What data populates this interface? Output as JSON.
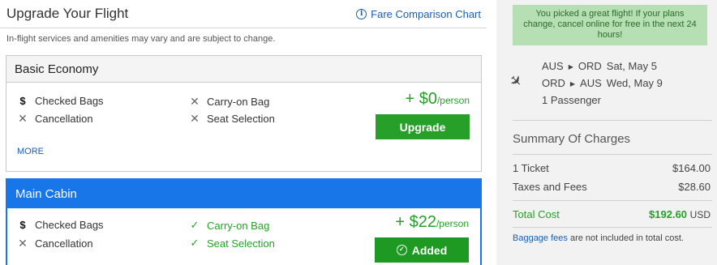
{
  "header": {
    "title": "Upgrade Your Flight",
    "fare_link": "Fare Comparison Chart",
    "disclaimer": "In-flight services and amenities may vary and are subject to change."
  },
  "fares": [
    {
      "name": "Basic Economy",
      "features": {
        "checked_bags": "Checked Bags",
        "cancellation": "Cancellation",
        "carry_on": "Carry-on Bag",
        "seat_selection": "Seat Selection"
      },
      "price": "+ $0",
      "per": "/person",
      "button": "Upgrade",
      "more": "MORE"
    },
    {
      "name": "Main Cabin",
      "features": {
        "checked_bags": "Checked Bags",
        "cancellation": "Cancellation",
        "carry_on": "Carry-on Bag",
        "seat_selection": "Seat Selection"
      },
      "price": "+ $22",
      "per": "/person",
      "button": "Added"
    }
  ],
  "sidebar": {
    "notice": "You picked a great flight! If your plans change, cancel online for free in the next 24 hours!",
    "itinerary": [
      {
        "from": "AUS",
        "to": "ORD",
        "date": "Sat, May 5"
      },
      {
        "from": "ORD",
        "to": "AUS",
        "date": "Wed, May 9"
      }
    ],
    "passengers": "1 Passenger",
    "summary_title": "Summary Of Charges",
    "charges": [
      {
        "label": "1 Ticket",
        "amount": "$164.00"
      },
      {
        "label": "Taxes and Fees",
        "amount": "$28.60"
      }
    ],
    "total": {
      "label": "Total Cost",
      "amount": "$192.60",
      "currency": "USD"
    },
    "baggage_link": "Baggage fees",
    "baggage_note": " are not included in total cost."
  },
  "colors": {
    "accent_blue": "#1976e8",
    "green": "#27a02a",
    "notice_bg": "#b6dfb4"
  }
}
